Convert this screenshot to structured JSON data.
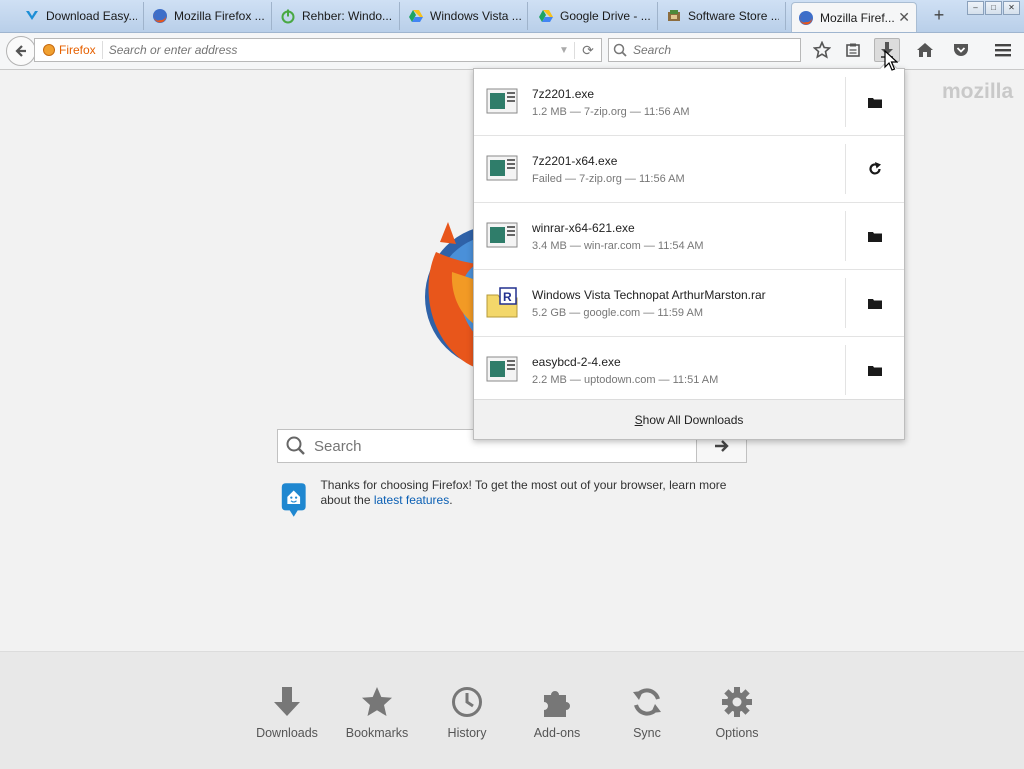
{
  "tabs": [
    {
      "label": "Download Easy...",
      "icon": "download-arrow-icon"
    },
    {
      "label": "Mozilla Firefox ...",
      "icon": "firefox-icon"
    },
    {
      "label": "Rehber: Windo...",
      "icon": "power-icon"
    },
    {
      "label": "Windows Vista ...",
      "icon": "google-drive-icon"
    },
    {
      "label": "Google Drive - ...",
      "icon": "google-drive-icon"
    },
    {
      "label": "Software Store ...",
      "icon": "software-store-icon"
    },
    {
      "label": "Mozilla Firef...",
      "icon": "firefox-icon",
      "active": true
    }
  ],
  "navbar": {
    "identity_label": "Firefox",
    "url_placeholder": "Search or enter address",
    "search_placeholder": "Search"
  },
  "content": {
    "brand": "mozilla",
    "search_placeholder": "Search",
    "snippet_text": "Thanks for choosing Firefox! To get the most out of your browser, learn more about the ",
    "snippet_link": "latest features",
    "snippet_end": "."
  },
  "downloads": {
    "items": [
      {
        "name": "7z2201.exe",
        "meta": "1.2 MB — 7-zip.org — 11:56 AM",
        "action": "open-folder",
        "type": "exe"
      },
      {
        "name": "7z2201-x64.exe",
        "meta": "Failed — 7-zip.org — 11:56 AM",
        "action": "retry",
        "type": "exe"
      },
      {
        "name": "winrar-x64-621.exe",
        "meta": "3.4 MB — win-rar.com — 11:54 AM",
        "action": "open-folder",
        "type": "exe"
      },
      {
        "name": "Windows Vista Technopat ArthurMarston.rar",
        "meta": "5.2 GB — google.com — 11:59 AM",
        "action": "open-folder",
        "type": "rar"
      },
      {
        "name": "easybcd-2-4.exe",
        "meta": "2.2 MB — uptodown.com — 11:51 AM",
        "action": "open-folder",
        "type": "exe"
      }
    ],
    "show_all_prefix": "S",
    "show_all_rest": "how All Downloads"
  },
  "launcher": [
    {
      "label": "Downloads",
      "icon": "download-icon"
    },
    {
      "label": "Bookmarks",
      "icon": "star-icon"
    },
    {
      "label": "History",
      "icon": "clock-icon"
    },
    {
      "label": "Add-ons",
      "icon": "puzzle-icon"
    },
    {
      "label": "Sync",
      "icon": "sync-icon"
    },
    {
      "label": "Options",
      "icon": "gear-icon"
    }
  ]
}
